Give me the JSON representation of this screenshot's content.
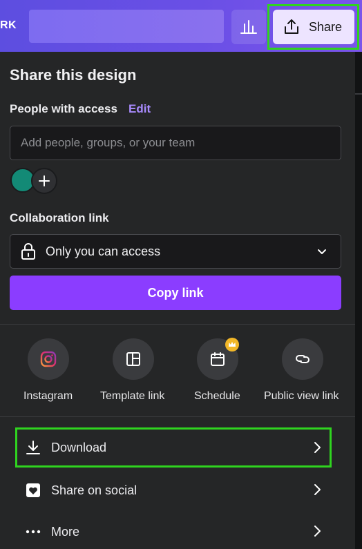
{
  "header": {
    "left_text": "RK",
    "share_label": "Share"
  },
  "panel": {
    "title": "Share this design",
    "people_with_access_label": "People with access",
    "edit_label": "Edit",
    "add_people_placeholder": "Add people, groups, or your team",
    "collaboration_link_label": "Collaboration link",
    "access_selected": "Only you can access",
    "copy_link_label": "Copy link"
  },
  "shortcuts": [
    {
      "label": "Instagram",
      "icon": "instagram-icon"
    },
    {
      "label": "Template link",
      "icon": "template-link-icon"
    },
    {
      "label": "Schedule",
      "icon": "calendar-icon",
      "badge": "crown-icon"
    },
    {
      "label": "Public view link",
      "icon": "link-icon"
    }
  ],
  "rows": [
    {
      "label": "Download",
      "icon": "download-icon"
    },
    {
      "label": "Share on social",
      "icon": "heart-icon"
    },
    {
      "label": "More",
      "icon": "more-icon"
    }
  ],
  "colors": {
    "accent": "#8b3dff",
    "edit_link": "#a98bff",
    "highlight": "#2fd41f",
    "avatar": "#138a76",
    "crown": "#f2b728"
  }
}
